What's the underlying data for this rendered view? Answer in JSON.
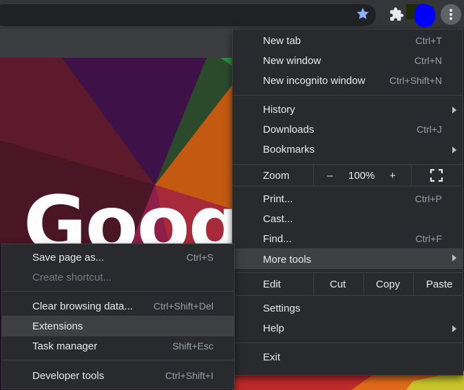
{
  "toolbar": {
    "star_icon": "star-icon",
    "extensions_icon": "puzzle-icon",
    "menu_icon": "more-vert-icon"
  },
  "page": {
    "logo_text": "Google"
  },
  "main_menu": {
    "new_tab": {
      "label": "New tab",
      "shortcut": "Ctrl+T"
    },
    "new_window": {
      "label": "New window",
      "shortcut": "Ctrl+N"
    },
    "new_incognito": {
      "label": "New incognito window",
      "shortcut": "Ctrl+Shift+N"
    },
    "history": {
      "label": "History"
    },
    "downloads": {
      "label": "Downloads",
      "shortcut": "Ctrl+J"
    },
    "bookmarks": {
      "label": "Bookmarks"
    },
    "zoom": {
      "label": "Zoom",
      "minus": "–",
      "value": "100%",
      "plus": "+"
    },
    "print": {
      "label": "Print...",
      "shortcut": "Ctrl+P"
    },
    "cast": {
      "label": "Cast..."
    },
    "find": {
      "label": "Find...",
      "shortcut": "Ctrl+F"
    },
    "more_tools": {
      "label": "More tools"
    },
    "edit": {
      "label": "Edit",
      "cut": "Cut",
      "copy": "Copy",
      "paste": "Paste"
    },
    "settings": {
      "label": "Settings"
    },
    "help": {
      "label": "Help"
    },
    "exit": {
      "label": "Exit"
    }
  },
  "sub_menu": {
    "save_page": {
      "label": "Save page as...",
      "shortcut": "Ctrl+S"
    },
    "create_shortcut": {
      "label": "Create shortcut..."
    },
    "clear_browsing": {
      "label": "Clear browsing data...",
      "shortcut": "Ctrl+Shift+Del"
    },
    "extensions": {
      "label": "Extensions"
    },
    "task_manager": {
      "label": "Task manager",
      "shortcut": "Shift+Esc"
    },
    "developer_tools": {
      "label": "Developer tools",
      "shortcut": "Ctrl+Shift+I"
    }
  }
}
